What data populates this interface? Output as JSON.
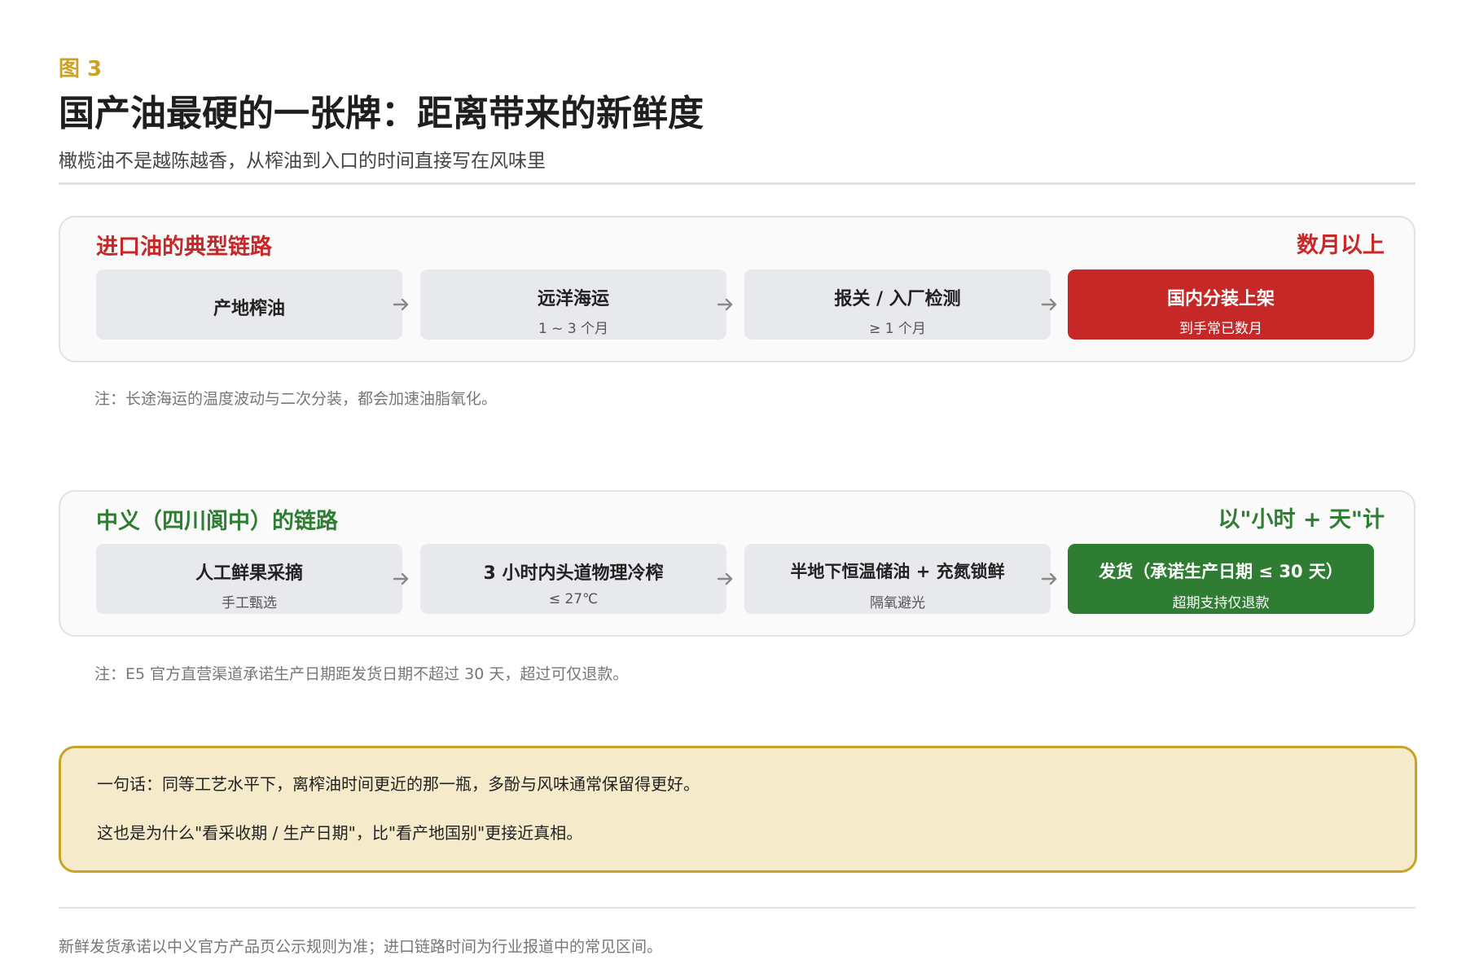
{
  "figure_label": "图 3",
  "title": "国产油最硬的一张牌：距离带来的新鲜度",
  "subtitle": "橄榄油不是越陈越香，从榨油到入口的时间直接写在风味里",
  "colors": {
    "gold": "#c9a227",
    "red": "#c62828",
    "green": "#2e7d32",
    "box_gray": "#e8e9ec",
    "summary_bg": "#f5ebca"
  },
  "imported": {
    "title": "进口油的典型链路",
    "tag": "数月以上",
    "steps": [
      {
        "main": "产地榨油",
        "sub": ""
      },
      {
        "main": "远洋海运",
        "sub": "1 ~ 3 个月"
      },
      {
        "main": "报关 / 入厂检测",
        "sub": "≥ 1 个月"
      },
      {
        "main": "国内分装上架",
        "sub": "到手常已数月"
      }
    ],
    "note": "注：长途海运的温度波动与二次分装，都会加速油脂氧化。"
  },
  "domestic": {
    "title": "中义（四川阆中）的链路",
    "tag": "以\"小时 + 天\"计",
    "steps": [
      {
        "main": "人工鲜果采摘",
        "sub": "手工甄选"
      },
      {
        "main": "3 小时内头道物理冷榨",
        "sub": "≤ 27℃"
      },
      {
        "main": "半地下恒温储油 + 充氮锁鲜",
        "sub": "隔氧避光"
      },
      {
        "main": "发货（承诺生产日期 ≤ 30 天）",
        "sub": "超期支持仅退款"
      }
    ],
    "note": "注：E5 官方直营渠道承诺生产日期距发货日期不超过 30 天，超过可仅退款。"
  },
  "summary": {
    "line1": "一句话：同等工艺水平下，离榨油时间更近的那一瓶，多酚与风味通常保留得更好。",
    "line2": "这也是为什么\"看采收期 / 生产日期\"，比\"看产地国别\"更接近真相。"
  },
  "footer": "新鲜发货承诺以中义官方产品页公示规则为准；进口链路时间为行业报道中的常见区间。"
}
